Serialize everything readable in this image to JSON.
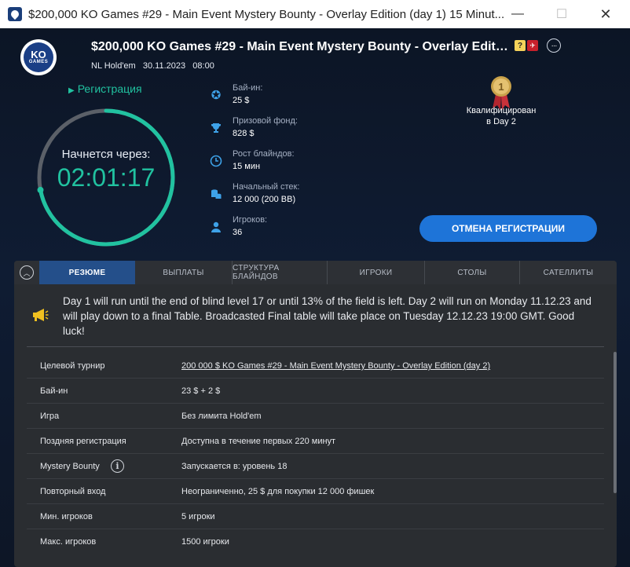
{
  "window": {
    "title": "$200,000 KO Games #29 - Main Event Mystery Bounty - Overlay Edition (day 1) 15 Minut...",
    "minimize": "—",
    "maximize": "☐",
    "close": "✕"
  },
  "header": {
    "logo_text": "KO",
    "logo_sub": "GAMES",
    "title": "$200,000 KO Games #29 - Main Event Mystery Bounty - Overlay Edition …",
    "subtitle": "NL Hold'em   30.11.2023   08:00",
    "badge_q": "?",
    "badge_red": "✈",
    "more": "···"
  },
  "registration": {
    "link_label": "Регистрация",
    "countdown_label": "Начнется через:",
    "countdown_value": "02:01:17",
    "progress": 0.72
  },
  "info": [
    {
      "icon": "poker-chip-icon",
      "glyph": "✪",
      "label": "Бай-ин:",
      "value": "25 $"
    },
    {
      "icon": "trophy-icon",
      "glyph": "🏆",
      "label": "Призовой фонд:",
      "value": "828 $"
    },
    {
      "icon": "clock-icon",
      "glyph": "◷",
      "label": "Рост блайндов:",
      "value": "15 мин"
    },
    {
      "icon": "chip-stack-icon",
      "glyph": "≋",
      "label": "Начальный стек:",
      "value": "12 000 (200 BB)"
    },
    {
      "icon": "user-icon",
      "glyph": "●",
      "label": "Игроков:",
      "value": "36"
    }
  ],
  "qualified": {
    "medal_number": "1",
    "line1": "Квалифицирован",
    "line2": "в Day 2"
  },
  "cancel_button": "ОТМЕНА РЕГИСТРАЦИИ",
  "tabs": [
    {
      "label": "РЕЗЮМЕ",
      "active": true
    },
    {
      "label": "ВЫПЛАТЫ",
      "active": false
    },
    {
      "label": "СТРУКТУРА БЛАЙНДОВ",
      "active": false
    },
    {
      "label": "ИГРОКИ",
      "active": false
    },
    {
      "label": "СТОЛЫ",
      "active": false
    },
    {
      "label": "САТЕЛЛИТЫ",
      "active": false
    }
  ],
  "notice": "Day 1 will run until the end of blind level 17 or until 13% of the field is left. Day 2 will run on Monday 11.12.23 and will play down to a final Table. Broadcasted Final table will take place on Tuesday 12.12.23 19:00 GMT. Good luck!",
  "details": [
    {
      "key": "Целевой турнир",
      "value": "200 000 $ KO Games #29 - Main Event Mystery Bounty - Overlay Edition (day 2)",
      "link": true
    },
    {
      "key": "Бай-ин",
      "value": "23 $ + 2 $"
    },
    {
      "key": "Игра",
      "value": "Без лимита Hold'em"
    },
    {
      "key": "Поздняя регистрация",
      "value": "Доступна в течение первых 220 минут"
    },
    {
      "key": "Mystery Bounty",
      "value": "Запускается в: уровень 18",
      "info": "i"
    },
    {
      "key": "Повторный вход",
      "value": "Неограниченно, 25 $ для покупки 12 000 фишек"
    },
    {
      "key": "Мин. игроков",
      "value": "5 игроки"
    },
    {
      "key": "Макс. игроков",
      "value": "1500 игроки"
    }
  ],
  "colors": {
    "accent_teal": "#21c2a0",
    "accent_blue": "#1e74d8",
    "tab_active": "#244f8a",
    "icon_blue": "#3ea2e8"
  }
}
